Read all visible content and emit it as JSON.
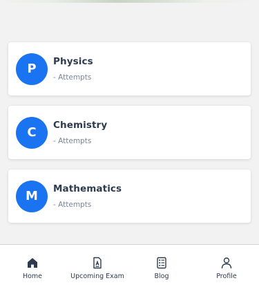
{
  "subjects": [
    {
      "initial": "P",
      "name": "Physics",
      "attempts": "- Attempts"
    },
    {
      "initial": "C",
      "name": "Chemistry",
      "attempts": "- Attempts"
    },
    {
      "initial": "M",
      "name": "Mathematics",
      "attempts": "- Attempts"
    }
  ],
  "nav": {
    "items": [
      {
        "label": "Home",
        "icon": "home-icon"
      },
      {
        "label": "Upcoming Exam",
        "icon": "exam-icon"
      },
      {
        "label": "Blog",
        "icon": "blog-icon"
      },
      {
        "label": "Profile",
        "icon": "profile-icon"
      }
    ]
  },
  "colors": {
    "accent": "#1a73f0",
    "background": "#f2f2f2",
    "card": "#ffffff",
    "text": "#2e3b4e",
    "muted": "#7b8594"
  }
}
